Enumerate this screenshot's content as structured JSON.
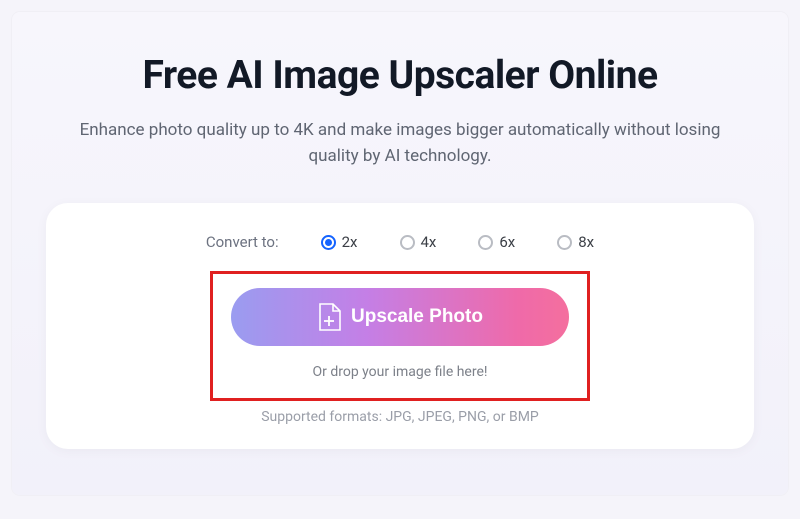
{
  "title": "Free AI Image Upscaler Online",
  "subtitle": "Enhance photo quality up to 4K and make images bigger automatically without losing quality by AI technology.",
  "convert": {
    "label": "Convert to:",
    "options": [
      "2x",
      "4x",
      "6x",
      "8x"
    ],
    "selected": "2x"
  },
  "upload": {
    "button_label": "Upscale Photo",
    "drop_text": "Or drop your image file here!",
    "formats_text": "Supported formats: JPG, JPEG, PNG, or BMP"
  },
  "colors": {
    "accent_blue": "#1463ff",
    "highlight_red": "#e02020",
    "gradient_start": "#9a9cf0",
    "gradient_end": "#f46f9e"
  }
}
